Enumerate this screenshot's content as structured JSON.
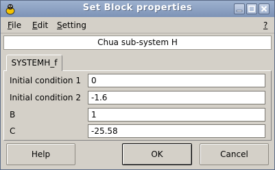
{
  "window": {
    "title": "Set Block properties",
    "icon": "scilab-icon",
    "controls": [
      "minimize-icon",
      "maximize-icon",
      "close-icon"
    ]
  },
  "menu": {
    "file": {
      "mnemonic": "F",
      "rest": "ile"
    },
    "edit": {
      "mnemonic": "E",
      "rest": "dit"
    },
    "setting": {
      "mnemonic": "S",
      "rest": "etting"
    },
    "help": {
      "mnemonic": "?"
    }
  },
  "subtitle": "Chua sub-system H",
  "tab": {
    "label": "SYSTEMH_f"
  },
  "fields": [
    {
      "label": "Initial condition 1",
      "value": "0"
    },
    {
      "label": "Initial condition 2",
      "value": "-1.6"
    },
    {
      "label": "B",
      "value": "1"
    },
    {
      "label": "C",
      "value": "-25.58"
    }
  ],
  "buttons": {
    "help": "Help",
    "ok": "OK",
    "cancel": "Cancel"
  }
}
